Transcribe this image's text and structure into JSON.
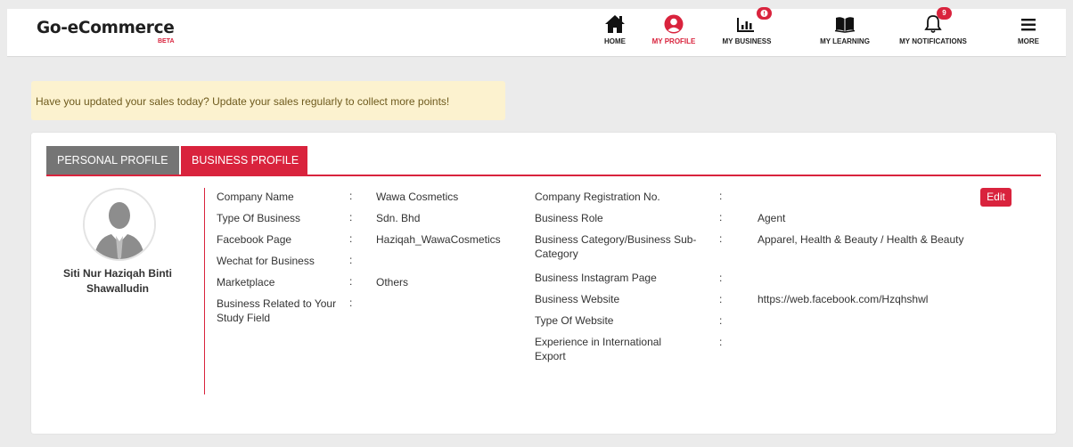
{
  "brand": {
    "name": "Go-eCommerce",
    "badge": "BETA"
  },
  "nav": {
    "home": "HOME",
    "profile": "MY PROFILE",
    "business": "MY BUSINESS",
    "learning": "MY LEARNING",
    "notifications": "MY NOTIFICATIONS",
    "notifications_badge": "9",
    "more": "MORE"
  },
  "colors": {
    "accent": "#d9233d",
    "tab_inactive": "#757575",
    "alert_bg": "#fcf2cf"
  },
  "alert": "Have you updated your sales today? Update your sales regularly to collect more points!",
  "tabs": {
    "personal": "PERSONAL PROFILE",
    "business": "BUSINESS PROFILE"
  },
  "profile": {
    "name": "Siti Nur Haziqah Binti Shawalludin"
  },
  "colon": ":",
  "edit_label": "Edit",
  "left_fields": [
    {
      "label": "Company Name",
      "value": "Wawa Cosmetics"
    },
    {
      "label": "Type Of Business",
      "value": "Sdn. Bhd"
    },
    {
      "label": "Facebook Page",
      "value": "Haziqah_WawaCosmetics"
    },
    {
      "label": "Wechat for Business",
      "value": ""
    },
    {
      "label": "Marketplace",
      "value": "Others"
    },
    {
      "label": "Business Related to Your Study Field",
      "value": ""
    }
  ],
  "right_fields": [
    {
      "label": "Company Registration No.",
      "value": ""
    },
    {
      "label": "Business Role",
      "value": "Agent"
    },
    {
      "label": "Business Category/Business Sub-Category",
      "value": "Apparel, Health & Beauty / Health & Beauty"
    },
    {
      "label": "Business Instagram Page",
      "value": ""
    },
    {
      "label": "Business Website",
      "value": "https://web.facebook.com/Hzqhshwl"
    },
    {
      "label": "Type Of Website",
      "value": ""
    },
    {
      "label": "Experience in International Export",
      "value": ""
    }
  ]
}
